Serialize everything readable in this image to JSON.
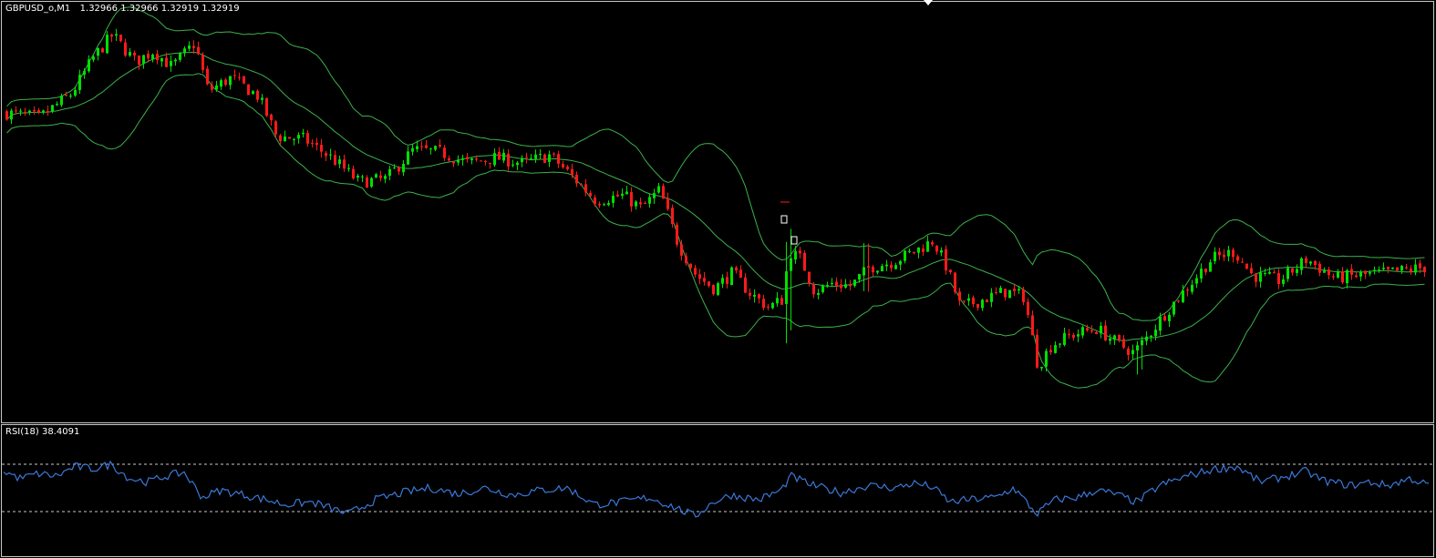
{
  "price_panel": {
    "symbol_timeframe": "GBPUSD_o,M1",
    "ohlc_text": "1.32966 1.32966 1.32919 1.32919"
  },
  "rsi_panel": {
    "label": "RSI(18) 38.4091"
  },
  "colors": {
    "background": "#000000",
    "frame": "#c8c8c8",
    "bull_candle": "#00e000",
    "bear_candle": "#ff1a1a",
    "bollinger": "#3cb14a",
    "rsi_line": "#3a78d8",
    "rsi_levels": "#c8c8c8"
  },
  "chart_data": [
    {
      "type": "candlestick",
      "instrument": "GBPUSD_o",
      "timeframe": "M1",
      "last_ohlc": {
        "open": 1.32966,
        "high": 1.32966,
        "low": 1.32919,
        "close": 1.32919
      },
      "close_path": [
        [
          0,
          1.3362
        ],
        [
          40,
          1.336
        ],
        [
          75,
          1.3369
        ],
        [
          100,
          1.3383
        ],
        [
          120,
          1.3391
        ],
        [
          145,
          1.3381
        ],
        [
          165,
          1.3385
        ],
        [
          185,
          1.3379
        ],
        [
          210,
          1.3388
        ],
        [
          225,
          1.337
        ],
        [
          250,
          1.3375
        ],
        [
          280,
          1.3368
        ],
        [
          300,
          1.3353
        ],
        [
          330,
          1.3352
        ],
        [
          360,
          1.3345
        ],
        [
          390,
          1.3336
        ],
        [
          420,
          1.3337
        ],
        [
          450,
          1.3348
        ],
        [
          480,
          1.3347
        ],
        [
          510,
          1.3343
        ],
        [
          540,
          1.3345
        ],
        [
          570,
          1.3343
        ],
        [
          600,
          1.3346
        ],
        [
          630,
          1.3336
        ],
        [
          650,
          1.3329
        ],
        [
          680,
          1.3331
        ],
        [
          700,
          1.3326
        ],
        [
          720,
          1.3333
        ],
        [
          740,
          1.3313
        ],
        [
          760,
          1.3301
        ],
        [
          780,
          1.3296
        ],
        [
          800,
          1.3302
        ],
        [
          820,
          1.3294
        ],
        [
          840,
          1.3289
        ],
        [
          855,
          1.3292
        ],
        [
          862,
          1.331
        ],
        [
          875,
          1.3307
        ],
        [
          890,
          1.3295
        ],
        [
          910,
          1.3298
        ],
        [
          930,
          1.3297
        ],
        [
          950,
          1.3304
        ],
        [
          975,
          1.3306
        ],
        [
          1000,
          1.331
        ],
        [
          1020,
          1.3314
        ],
        [
          1035,
          1.3304
        ],
        [
          1050,
          1.3289
        ],
        [
          1075,
          1.3292
        ],
        [
          1100,
          1.3295
        ],
        [
          1120,
          1.3293
        ],
        [
          1135,
          1.3267
        ],
        [
          1150,
          1.3275
        ],
        [
          1175,
          1.3279
        ],
        [
          1200,
          1.3281
        ],
        [
          1220,
          1.3276
        ],
        [
          1240,
          1.3272
        ],
        [
          1255,
          1.3278
        ],
        [
          1275,
          1.3287
        ],
        [
          1300,
          1.3297
        ],
        [
          1325,
          1.3307
        ],
        [
          1350,
          1.331
        ],
        [
          1370,
          1.3301
        ],
        [
          1400,
          1.3299
        ],
        [
          1430,
          1.3307
        ],
        [
          1460,
          1.33
        ],
        [
          1490,
          1.3301
        ],
        [
          1520,
          1.3302
        ],
        [
          1560,
          1.3304
        ]
      ],
      "overlays": [
        "Bollinger Bands"
      ]
    },
    {
      "type": "line",
      "indicator": "RSI",
      "period": 18,
      "last_value": 38.4091,
      "levels": [
        70,
        30
      ],
      "ylim": [
        0,
        100
      ],
      "series_path": [
        [
          0,
          65
        ],
        [
          20,
          58
        ],
        [
          40,
          62
        ],
        [
          60,
          60
        ],
        [
          80,
          68
        ],
        [
          100,
          66
        ],
        [
          120,
          70
        ],
        [
          140,
          58
        ],
        [
          160,
          55
        ],
        [
          180,
          60
        ],
        [
          200,
          63
        ],
        [
          220,
          42
        ],
        [
          240,
          48
        ],
        [
          260,
          45
        ],
        [
          290,
          40
        ],
        [
          310,
          36
        ],
        [
          340,
          38
        ],
        [
          380,
          28
        ],
        [
          410,
          40
        ],
        [
          440,
          46
        ],
        [
          470,
          50
        ],
        [
          500,
          45
        ],
        [
          530,
          50
        ],
        [
          560,
          44
        ],
        [
          590,
          48
        ],
        [
          620,
          50
        ],
        [
          650,
          36
        ],
        [
          680,
          38
        ],
        [
          710,
          42
        ],
        [
          740,
          33
        ],
        [
          760,
          26
        ],
        [
          780,
          38
        ],
        [
          800,
          44
        ],
        [
          830,
          40
        ],
        [
          855,
          48
        ],
        [
          865,
          60
        ],
        [
          890,
          52
        ],
        [
          920,
          46
        ],
        [
          950,
          52
        ],
        [
          980,
          50
        ],
        [
          1000,
          54
        ],
        [
          1020,
          51
        ],
        [
          1040,
          38
        ],
        [
          1060,
          40
        ],
        [
          1090,
          42
        ],
        [
          1110,
          50
        ],
        [
          1135,
          28
        ],
        [
          1155,
          40
        ],
        [
          1180,
          42
        ],
        [
          1200,
          48
        ],
        [
          1220,
          45
        ],
        [
          1245,
          38
        ],
        [
          1270,
          52
        ],
        [
          1300,
          60
        ],
        [
          1330,
          66
        ],
        [
          1355,
          68
        ],
        [
          1380,
          55
        ],
        [
          1410,
          60
        ],
        [
          1430,
          64
        ],
        [
          1450,
          56
        ],
        [
          1480,
          52
        ],
        [
          1500,
          55
        ],
        [
          1520,
          52
        ],
        [
          1545,
          58
        ],
        [
          1565,
          52
        ]
      ]
    }
  ]
}
